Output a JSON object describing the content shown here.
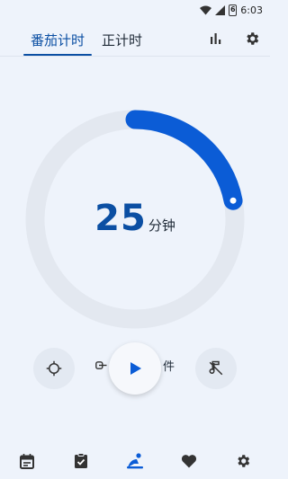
{
  "status_bar": {
    "time": "6:03",
    "battery_level": "6"
  },
  "tabs": [
    {
      "label": "番茄计时",
      "active": true
    },
    {
      "label": "正计时",
      "active": false
    }
  ],
  "header_icons": [
    "bar-chart-icon",
    "gear-icon"
  ],
  "timer": {
    "value": "25",
    "unit": "分钟",
    "progress_fraction": 0.22,
    "accent_color": "#0b5cd6",
    "track_color": "#e3e8f0"
  },
  "controls": {
    "left_icon": "crosshair-icon",
    "right_icon": "mute-icon",
    "widget_label_left": "",
    "widget_label_right": "件",
    "play_icon": "play-icon"
  },
  "bottom_nav": [
    {
      "icon": "calendar-icon",
      "active": false
    },
    {
      "icon": "clipboard-check-icon",
      "active": false
    },
    {
      "icon": "focus-person-icon",
      "active": true
    },
    {
      "icon": "heart-icon",
      "active": false
    },
    {
      "icon": "gear-icon",
      "active": false
    }
  ]
}
